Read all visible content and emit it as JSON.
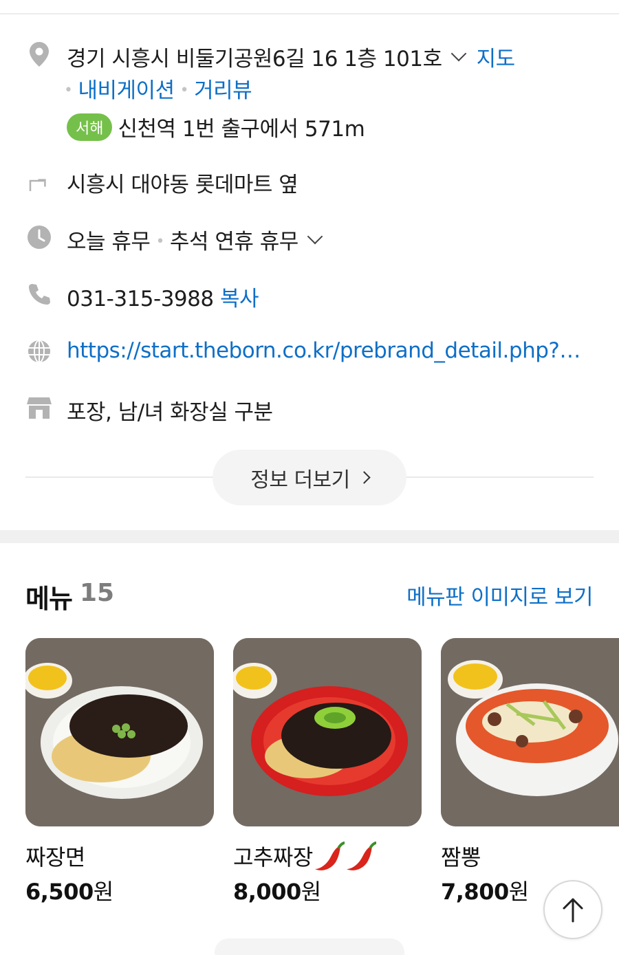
{
  "info": {
    "address": "경기 시흥시 비둘기공원6길 16 1층 101호",
    "map_link": "지도",
    "navigation_link": "내비게이션",
    "street_view_link": "거리뷰",
    "subway_line": "서해",
    "subway_distance": "신천역 1번 출구에서 571m",
    "directions": "시흥시 대야동 롯데마트 옆",
    "hours_today": "오늘 휴무",
    "hours_note": "추석 연휴 휴무",
    "phone": "031-315-3988",
    "copy_label": "복사",
    "website": "https://start.theborn.co.kr/prebrand_detail.php?b...",
    "amenities": "포장, 남/녀 화장실 구분",
    "more_button": "정보 더보기"
  },
  "menu": {
    "title": "메뉴",
    "count": "15",
    "board_link": "메뉴판 이미지로 보기",
    "items": [
      {
        "name": "짜장면",
        "price": "6,500",
        "unit": "원",
        "spicy": 0
      },
      {
        "name": "고추짜장",
        "price": "8,000",
        "unit": "원",
        "spicy": 2
      },
      {
        "name": "짬뽕",
        "price": "7,800",
        "unit": "원",
        "spicy": 0
      }
    ]
  },
  "colors": {
    "link": "#0e6fc7",
    "subway_badge": "#75c04a",
    "icon_gray": "#b3b3b3"
  },
  "icons": [
    "location-pin-icon",
    "turn-arrow-icon",
    "clock-icon",
    "phone-icon",
    "globe-icon",
    "store-icon",
    "chevron-down-icon",
    "chevron-right-icon",
    "arrow-up-icon",
    "chili-pepper-icon"
  ]
}
